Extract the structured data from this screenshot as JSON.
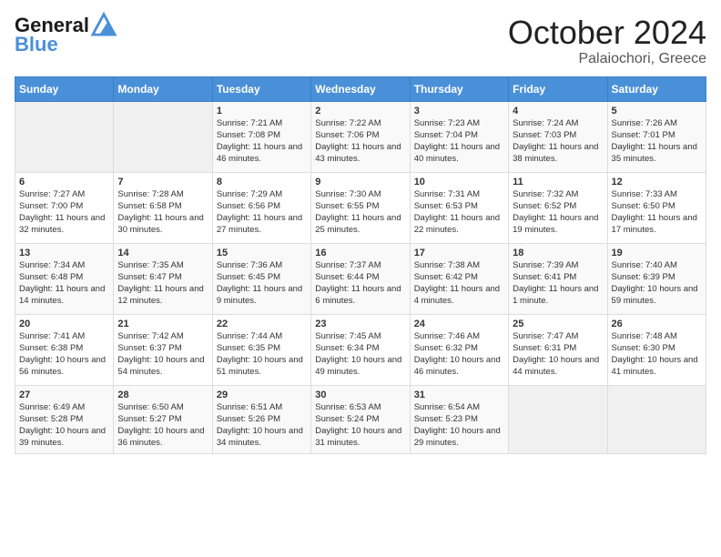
{
  "header": {
    "logo_line1": "General",
    "logo_line2": "Blue",
    "month": "October 2024",
    "location": "Palaiochori, Greece"
  },
  "columns": [
    "Sunday",
    "Monday",
    "Tuesday",
    "Wednesday",
    "Thursday",
    "Friday",
    "Saturday"
  ],
  "weeks": [
    [
      {
        "day": "",
        "info": ""
      },
      {
        "day": "",
        "info": ""
      },
      {
        "day": "1",
        "info": "Sunrise: 7:21 AM\nSunset: 7:08 PM\nDaylight: 11 hours and 46 minutes."
      },
      {
        "day": "2",
        "info": "Sunrise: 7:22 AM\nSunset: 7:06 PM\nDaylight: 11 hours and 43 minutes."
      },
      {
        "day": "3",
        "info": "Sunrise: 7:23 AM\nSunset: 7:04 PM\nDaylight: 11 hours and 40 minutes."
      },
      {
        "day": "4",
        "info": "Sunrise: 7:24 AM\nSunset: 7:03 PM\nDaylight: 11 hours and 38 minutes."
      },
      {
        "day": "5",
        "info": "Sunrise: 7:26 AM\nSunset: 7:01 PM\nDaylight: 11 hours and 35 minutes."
      }
    ],
    [
      {
        "day": "6",
        "info": "Sunrise: 7:27 AM\nSunset: 7:00 PM\nDaylight: 11 hours and 32 minutes."
      },
      {
        "day": "7",
        "info": "Sunrise: 7:28 AM\nSunset: 6:58 PM\nDaylight: 11 hours and 30 minutes."
      },
      {
        "day": "8",
        "info": "Sunrise: 7:29 AM\nSunset: 6:56 PM\nDaylight: 11 hours and 27 minutes."
      },
      {
        "day": "9",
        "info": "Sunrise: 7:30 AM\nSunset: 6:55 PM\nDaylight: 11 hours and 25 minutes."
      },
      {
        "day": "10",
        "info": "Sunrise: 7:31 AM\nSunset: 6:53 PM\nDaylight: 11 hours and 22 minutes."
      },
      {
        "day": "11",
        "info": "Sunrise: 7:32 AM\nSunset: 6:52 PM\nDaylight: 11 hours and 19 minutes."
      },
      {
        "day": "12",
        "info": "Sunrise: 7:33 AM\nSunset: 6:50 PM\nDaylight: 11 hours and 17 minutes."
      }
    ],
    [
      {
        "day": "13",
        "info": "Sunrise: 7:34 AM\nSunset: 6:48 PM\nDaylight: 11 hours and 14 minutes."
      },
      {
        "day": "14",
        "info": "Sunrise: 7:35 AM\nSunset: 6:47 PM\nDaylight: 11 hours and 12 minutes."
      },
      {
        "day": "15",
        "info": "Sunrise: 7:36 AM\nSunset: 6:45 PM\nDaylight: 11 hours and 9 minutes."
      },
      {
        "day": "16",
        "info": "Sunrise: 7:37 AM\nSunset: 6:44 PM\nDaylight: 11 hours and 6 minutes."
      },
      {
        "day": "17",
        "info": "Sunrise: 7:38 AM\nSunset: 6:42 PM\nDaylight: 11 hours and 4 minutes."
      },
      {
        "day": "18",
        "info": "Sunrise: 7:39 AM\nSunset: 6:41 PM\nDaylight: 11 hours and 1 minute."
      },
      {
        "day": "19",
        "info": "Sunrise: 7:40 AM\nSunset: 6:39 PM\nDaylight: 10 hours and 59 minutes."
      }
    ],
    [
      {
        "day": "20",
        "info": "Sunrise: 7:41 AM\nSunset: 6:38 PM\nDaylight: 10 hours and 56 minutes."
      },
      {
        "day": "21",
        "info": "Sunrise: 7:42 AM\nSunset: 6:37 PM\nDaylight: 10 hours and 54 minutes."
      },
      {
        "day": "22",
        "info": "Sunrise: 7:44 AM\nSunset: 6:35 PM\nDaylight: 10 hours and 51 minutes."
      },
      {
        "day": "23",
        "info": "Sunrise: 7:45 AM\nSunset: 6:34 PM\nDaylight: 10 hours and 49 minutes."
      },
      {
        "day": "24",
        "info": "Sunrise: 7:46 AM\nSunset: 6:32 PM\nDaylight: 10 hours and 46 minutes."
      },
      {
        "day": "25",
        "info": "Sunrise: 7:47 AM\nSunset: 6:31 PM\nDaylight: 10 hours and 44 minutes."
      },
      {
        "day": "26",
        "info": "Sunrise: 7:48 AM\nSunset: 6:30 PM\nDaylight: 10 hours and 41 minutes."
      }
    ],
    [
      {
        "day": "27",
        "info": "Sunrise: 6:49 AM\nSunset: 5:28 PM\nDaylight: 10 hours and 39 minutes."
      },
      {
        "day": "28",
        "info": "Sunrise: 6:50 AM\nSunset: 5:27 PM\nDaylight: 10 hours and 36 minutes."
      },
      {
        "day": "29",
        "info": "Sunrise: 6:51 AM\nSunset: 5:26 PM\nDaylight: 10 hours and 34 minutes."
      },
      {
        "day": "30",
        "info": "Sunrise: 6:53 AM\nSunset: 5:24 PM\nDaylight: 10 hours and 31 minutes."
      },
      {
        "day": "31",
        "info": "Sunrise: 6:54 AM\nSunset: 5:23 PM\nDaylight: 10 hours and 29 minutes."
      },
      {
        "day": "",
        "info": ""
      },
      {
        "day": "",
        "info": ""
      }
    ]
  ]
}
